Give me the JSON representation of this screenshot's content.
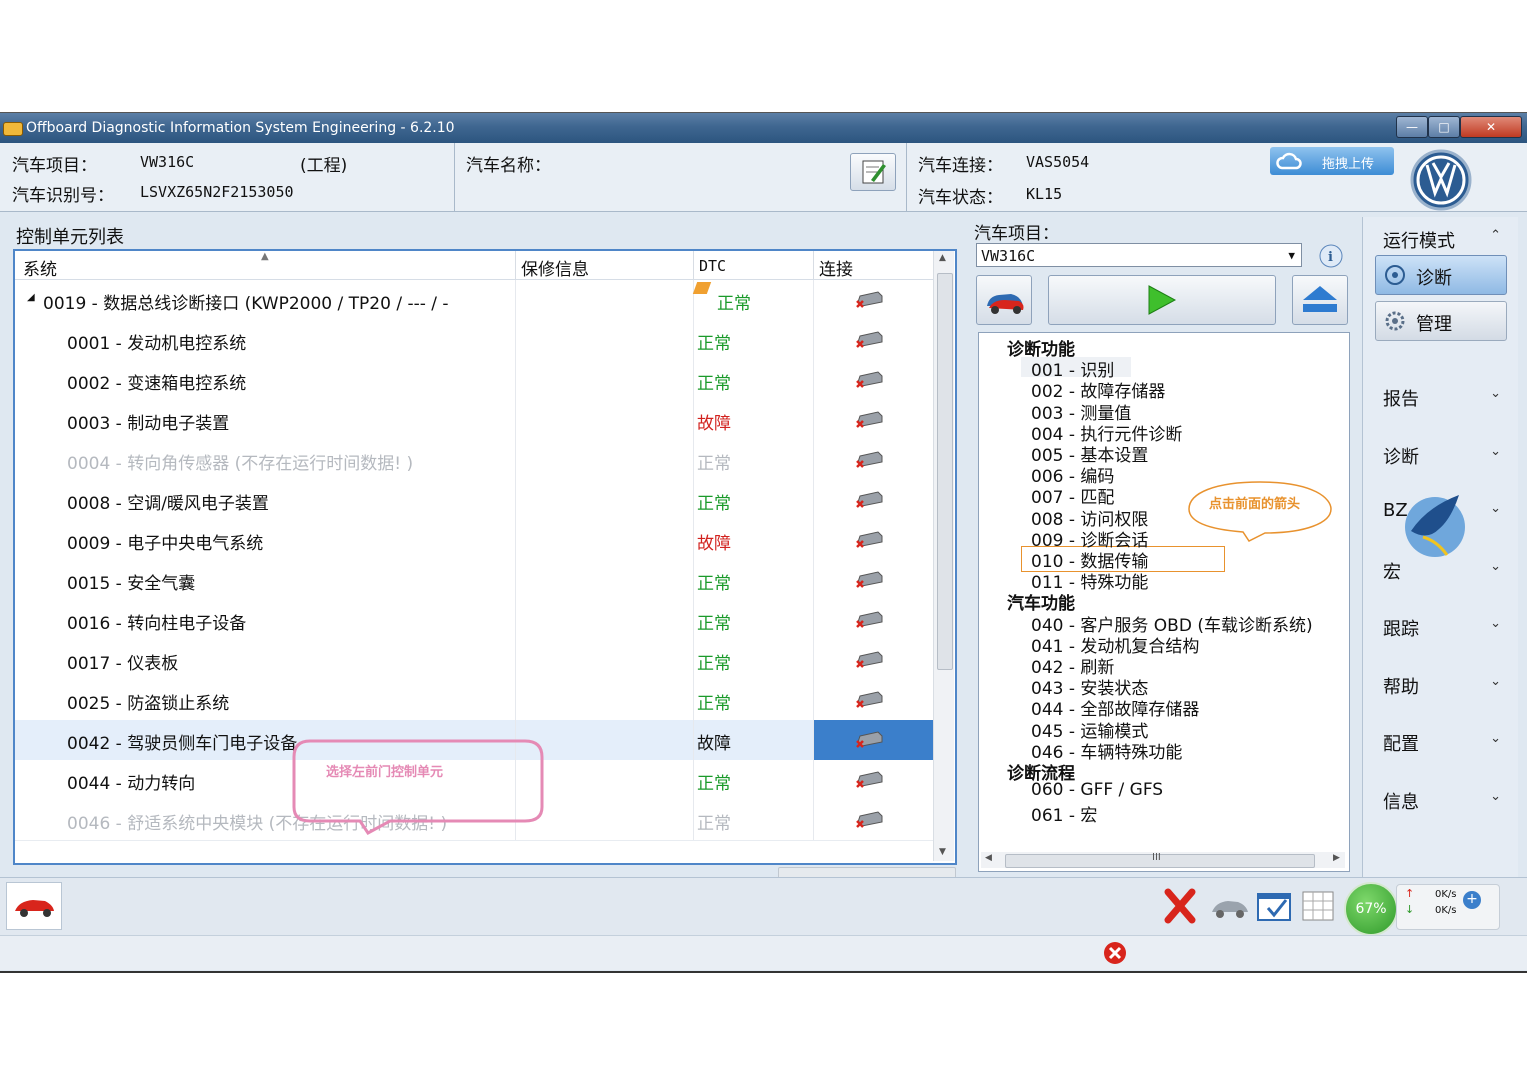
{
  "window": {
    "title": "Offboard Diagnostic Information System Engineering - 6.2.10"
  },
  "header": {
    "project_label": "汽车项目：",
    "project_value": "VW316C",
    "project_mode": "(工程)",
    "vin_label": "汽车识别号：",
    "vin_value": "LSVXZ65N2F2153050",
    "name_label": "汽车名称：",
    "connection_label": "汽车连接：",
    "connection_value": "VAS5054",
    "state_label": "汽车状态：",
    "state_value": "KL15",
    "upload_button": "拖拽上传"
  },
  "control_units": {
    "title": "控制单元列表",
    "columns": [
      "系统",
      "保修信息",
      "DTC",
      "连接"
    ],
    "rows": [
      {
        "name": "0019 - 数据总线诊断接口  (KWP2000 / TP20 / --- / -",
        "dtc": "正常",
        "status": "ok",
        "root": true
      },
      {
        "name": "0001 - 发动机电控系统",
        "dtc": "正常",
        "status": "ok"
      },
      {
        "name": "0002 - 变速箱电控系统",
        "dtc": "正常",
        "status": "ok"
      },
      {
        "name": "0003 - 制动电子装置",
        "dtc": "故障",
        "status": "fault"
      },
      {
        "name": "0004 - 转向角传感器  (不存在运行时间数据! )",
        "dtc": "正常",
        "status": "dim"
      },
      {
        "name": "0008 - 空调/暖风电子装置",
        "dtc": "正常",
        "status": "ok"
      },
      {
        "name": "0009 - 电子中央电气系统",
        "dtc": "故障",
        "status": "fault"
      },
      {
        "name": "0015 - 安全气囊",
        "dtc": "正常",
        "status": "ok"
      },
      {
        "name": "0016 - 转向柱电子设备",
        "dtc": "正常",
        "status": "ok"
      },
      {
        "name": "0017 - 仪表板",
        "dtc": "正常",
        "status": "ok"
      },
      {
        "name": "0025 - 防盗锁止系统",
        "dtc": "正常",
        "status": "ok"
      },
      {
        "name": "0042 - 驾驶员侧车门电子设备",
        "dtc": "故障",
        "status": "selected"
      },
      {
        "name": "0044 - 动力转向",
        "dtc": "正常",
        "status": "ok"
      },
      {
        "name": "0046 - 舒适系统中央模块  (不存在运行时间数据! )",
        "dtc": "正常",
        "status": "dim"
      }
    ],
    "callout": "选择左前门控制单元"
  },
  "functions": {
    "project_label": "汽车项目：",
    "project_select": "VW316C",
    "groups": [
      {
        "title": "诊断功能",
        "items": [
          "001 - 识别",
          "002 - 故障存储器",
          "003 - 测量值",
          "004 - 执行元件诊断",
          "005 - 基本设置",
          "006 - 编码",
          "007 - 匹配",
          "008 - 访问权限",
          "009 - 诊断会话",
          "010 - 数据传输",
          "011 - 特殊功能"
        ]
      },
      {
        "title": "汽车功能",
        "items": [
          "040 - 客户服务 OBD (车载诊断系统)",
          "041 - 发动机复合结构",
          "042 - 刷新",
          "043 - 安装状态",
          "044 - 全部故障存储器",
          "045 - 运输模式",
          "046 - 车辆特殊功能"
        ]
      },
      {
        "title": "诊断流程",
        "items": [
          "060 - GFF / GFS",
          "061 - 宏"
        ]
      }
    ],
    "callout": "点击前面的箭头",
    "scroll_mark": "III"
  },
  "sidebar": {
    "run_mode": "运行模式",
    "diagnose_button": "诊断",
    "manage_button": "管理",
    "sections": [
      "报告",
      "诊断",
      "BZ",
      "宏",
      "跟踪",
      "帮助",
      "配置",
      "信息"
    ]
  },
  "status": {
    "percent": "67%",
    "up_speed": "0K/s",
    "down_speed": "0K/s"
  },
  "colors": {
    "ok": "#1a9a2a",
    "fault": "#d2231f",
    "accent": "#3b7fcb"
  }
}
